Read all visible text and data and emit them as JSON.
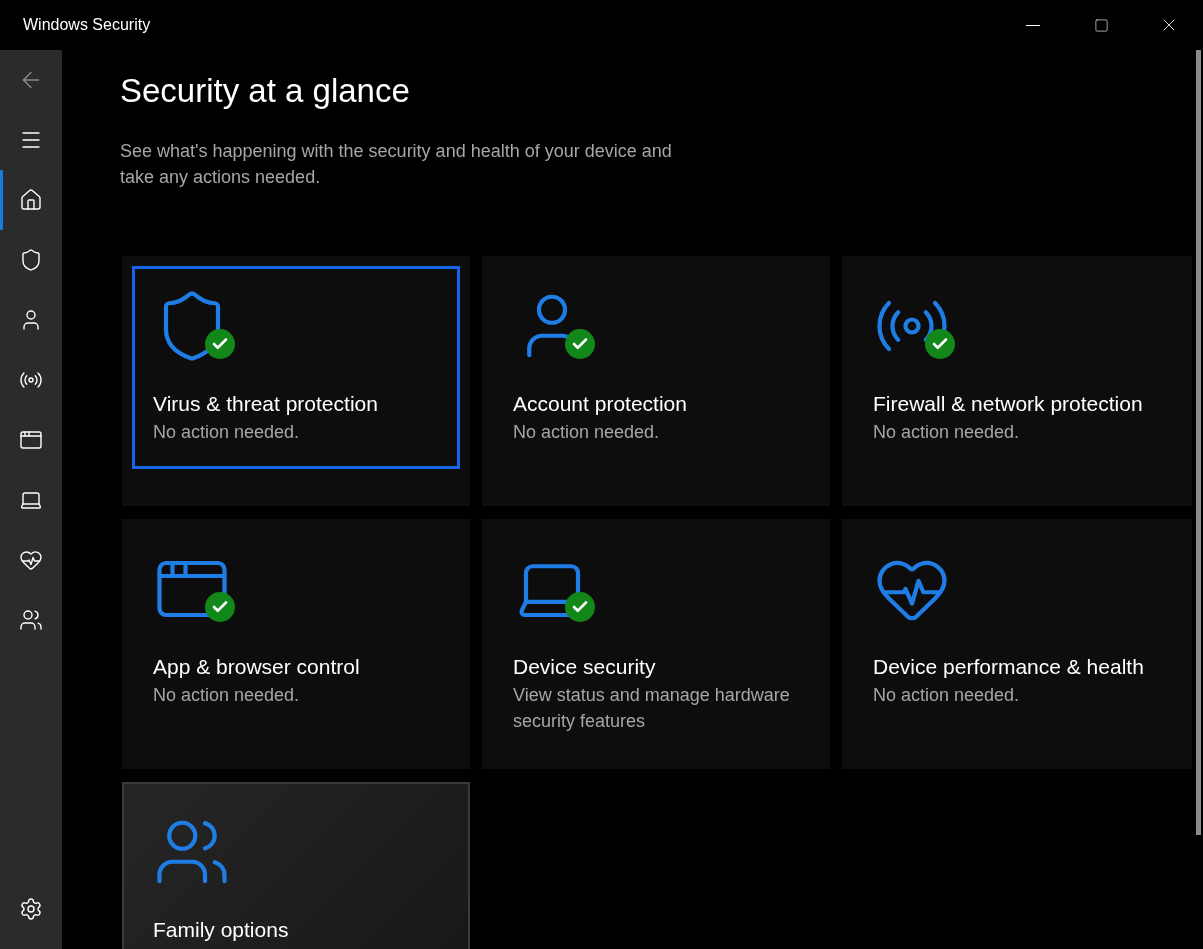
{
  "window": {
    "title": "Windows Security"
  },
  "sidebar": {
    "items": [
      {
        "kind": "home",
        "selected": true
      },
      {
        "kind": "shield",
        "selected": false
      },
      {
        "kind": "person",
        "selected": false
      },
      {
        "kind": "antenna",
        "selected": false
      },
      {
        "kind": "window",
        "selected": false
      },
      {
        "kind": "laptop",
        "selected": false
      },
      {
        "kind": "heart",
        "selected": false
      },
      {
        "kind": "family",
        "selected": false
      }
    ]
  },
  "page": {
    "title": "Security at a glance",
    "subtitle": "See what's happening with the security and health of your device and take any actions needed."
  },
  "tiles": [
    {
      "kind": "shield",
      "title": "Virus & threat protection",
      "status": "No action needed.",
      "ok": true,
      "focused": true,
      "hovered": false
    },
    {
      "kind": "person",
      "title": "Account protection",
      "status": "No action needed.",
      "ok": true,
      "focused": false,
      "hovered": false
    },
    {
      "kind": "antenna",
      "title": "Firewall & network protection",
      "status": "No action needed.",
      "ok": true,
      "focused": false,
      "hovered": false
    },
    {
      "kind": "window",
      "title": "App & browser control",
      "status": "No action needed.",
      "ok": true,
      "focused": false,
      "hovered": false
    },
    {
      "kind": "laptop",
      "title": "Device security",
      "status": "View status and manage hardware security features",
      "ok": true,
      "focused": false,
      "hovered": false
    },
    {
      "kind": "heart",
      "title": "Device performance & health",
      "status": "No action needed.",
      "ok": false,
      "focused": false,
      "hovered": false
    },
    {
      "kind": "family",
      "title": "Family options",
      "ok": false,
      "focused": false,
      "hovered": true
    }
  ]
}
